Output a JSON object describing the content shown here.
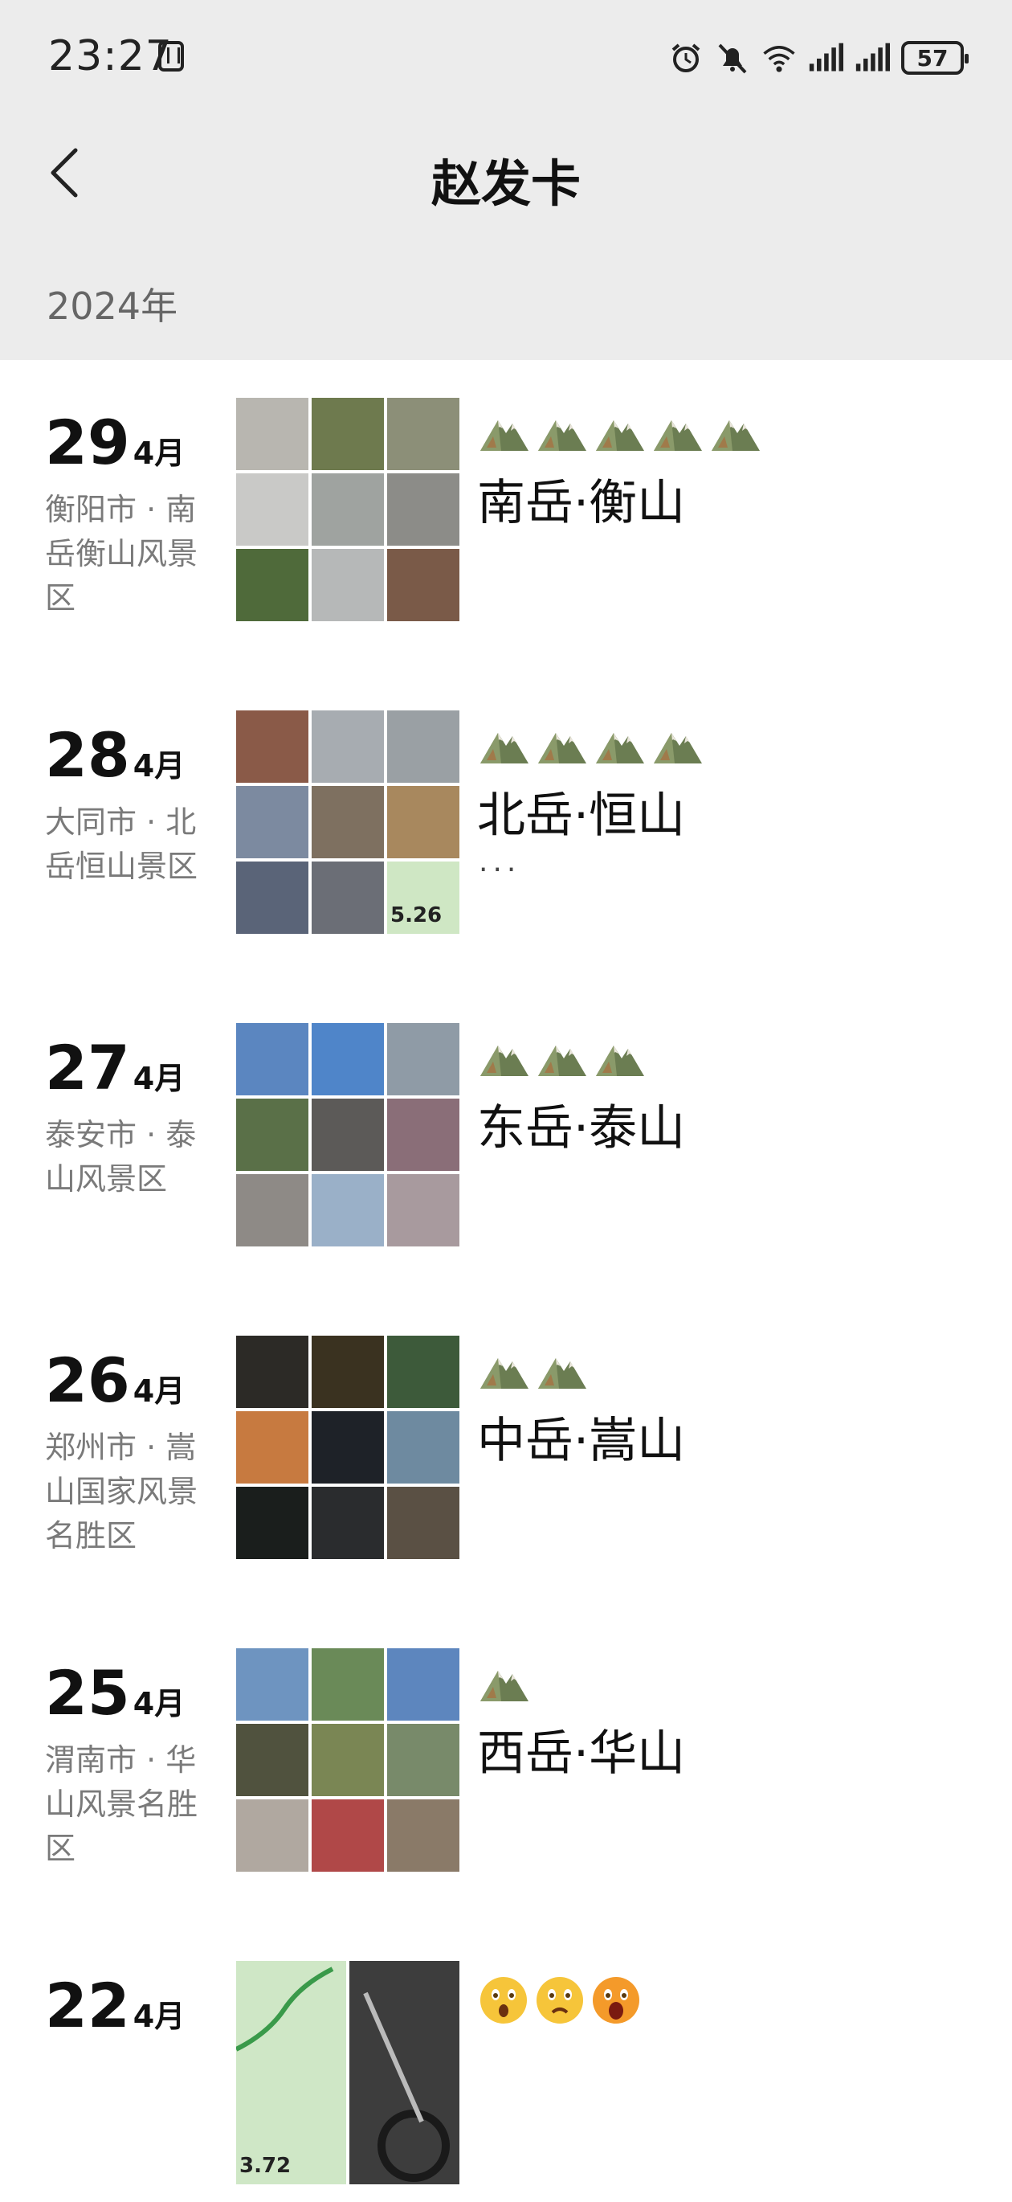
{
  "status": {
    "time": "23:27",
    "battery": "57"
  },
  "nav": {
    "title": "赵发卡"
  },
  "year_label": "2024年",
  "entries": [
    {
      "day": "29",
      "month": "4月",
      "location": "衡阳市 · 南岳衡山风景区",
      "caption": "南岳·衡山",
      "more": "",
      "emoji": "mountain",
      "emoji_count": 5,
      "thumbs": [
        "#b8b6b0",
        "#6e7a4e",
        "#8c8f78",
        "#c9c9c7",
        "#9fa3a0",
        "#8c8c88",
        "#4f6a3a",
        "#b6b8b8",
        "#7a5a48"
      ]
    },
    {
      "day": "28",
      "month": "4月",
      "location": "大同市 · 北岳恒山景区",
      "caption": "北岳·恒山",
      "more": "···",
      "emoji": "mountain",
      "emoji_count": 4,
      "thumbs": [
        "#8a5a48",
        "#a7acb1",
        "#9aa0a4",
        "#7c8aa0",
        "#7e7060",
        "#a8885e",
        "#5a6478",
        "#6b6e76",
        "#cfe7c4"
      ],
      "thumb_label": "5.26"
    },
    {
      "day": "27",
      "month": "4月",
      "location": "泰安市 · 泰山风景区",
      "caption": "东岳·泰山",
      "more": "",
      "emoji": "mountain",
      "emoji_count": 3,
      "thumbs": [
        "#5b86c0",
        "#4f85c9",
        "#8f9ba6",
        "#5a7048",
        "#5c5a58",
        "#8a6e78",
        "#8e8a86",
        "#9ab0c8",
        "#a89a9e"
      ]
    },
    {
      "day": "26",
      "month": "4月",
      "location": "郑州市 · 嵩山国家风景名胜区",
      "caption": "中岳·嵩山",
      "more": "",
      "emoji": "mountain",
      "emoji_count": 2,
      "thumbs": [
        "#2c2a26",
        "#3a3220",
        "#3d5a3a",
        "#c77a40",
        "#1e2228",
        "#6e8aa0",
        "#1a1e1c",
        "#2a2c2e",
        "#5a5044"
      ]
    },
    {
      "day": "25",
      "month": "4月",
      "location": "渭南市 · 华山风景名胜区",
      "caption": "西岳·华山",
      "more": "",
      "emoji": "mountain",
      "emoji_count": 1,
      "thumbs": [
        "#6e94c0",
        "#6a8a58",
        "#5d86be",
        "#50523e",
        "#7a8654",
        "#788a6a",
        "#b0a8a0",
        "#b04848",
        "#8a7a68"
      ]
    },
    {
      "day": "22",
      "month": "4月",
      "location": "",
      "caption": "",
      "more": "",
      "emoji": "faces",
      "emoji_count": 3,
      "thumbs": [
        "#cfe7c6",
        "#3d3d3d"
      ],
      "thumb_label": "3.72"
    }
  ]
}
